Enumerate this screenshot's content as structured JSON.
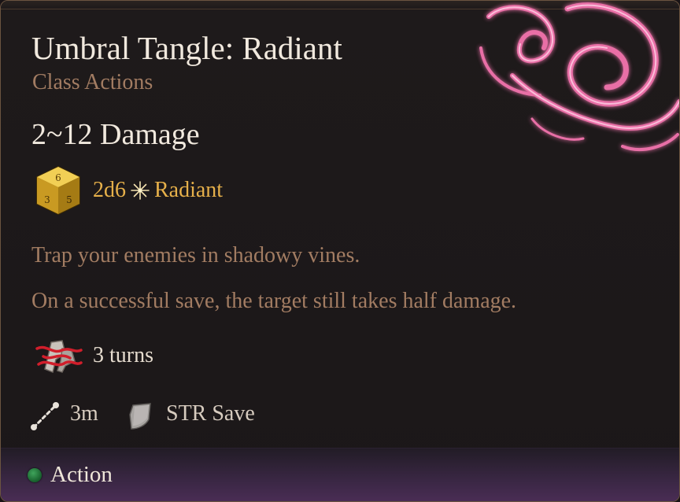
{
  "spell": {
    "title": "Umbral Tangle: Radiant",
    "category": "Class Actions",
    "damage_range": "2~12 Damage",
    "dice": "2d6",
    "damage_type": "Radiant",
    "description": "Trap your enemies in shadowy vines.",
    "save_note": "On a successful save, the target still takes half damage.",
    "duration": "3 turns",
    "range": "3m",
    "save": "STR Save",
    "cost": "Action"
  },
  "icons": {
    "dice": "d6-dice-icon",
    "damage_type": "radiant-spark-icon",
    "status": "entangled-status-icon",
    "range": "range-icon",
    "save": "shield-save-icon",
    "cost": "action-resource-icon",
    "art": "vine-swirl-art"
  },
  "colors": {
    "title": "#f1e9de",
    "muted": "#a27c62",
    "dice_text": "#e6b04a",
    "action_dot": "#2e8a46",
    "swirl": "#ff6fb0",
    "footer": "#4a2d55"
  }
}
